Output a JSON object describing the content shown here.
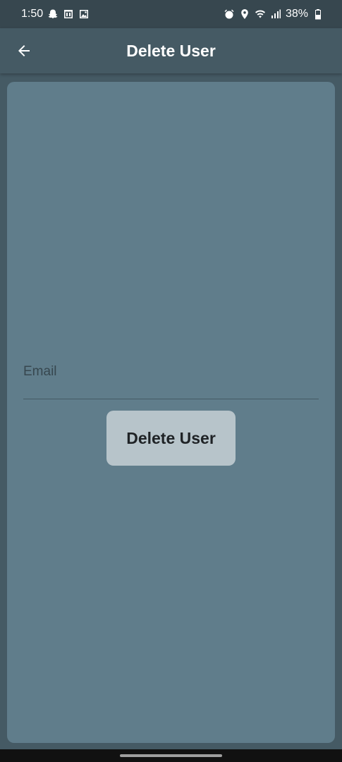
{
  "status_bar": {
    "time": "1:50",
    "left_icons": [
      "snapchat-icon",
      "calendar-icon",
      "gallery-icon"
    ],
    "right_icons": [
      "alarm-icon",
      "location-icon",
      "wifi-icon",
      "signal-icon"
    ],
    "battery": "38%"
  },
  "app_bar": {
    "title": "Delete User",
    "back_icon": "arrow-left-icon"
  },
  "form": {
    "email_label": "Email",
    "email_value": "",
    "button_label": "Delete User"
  },
  "colors": {
    "background": "#455a64",
    "card": "#607d8b",
    "button": "#b7c4ca",
    "status_bar": "#37474f"
  }
}
